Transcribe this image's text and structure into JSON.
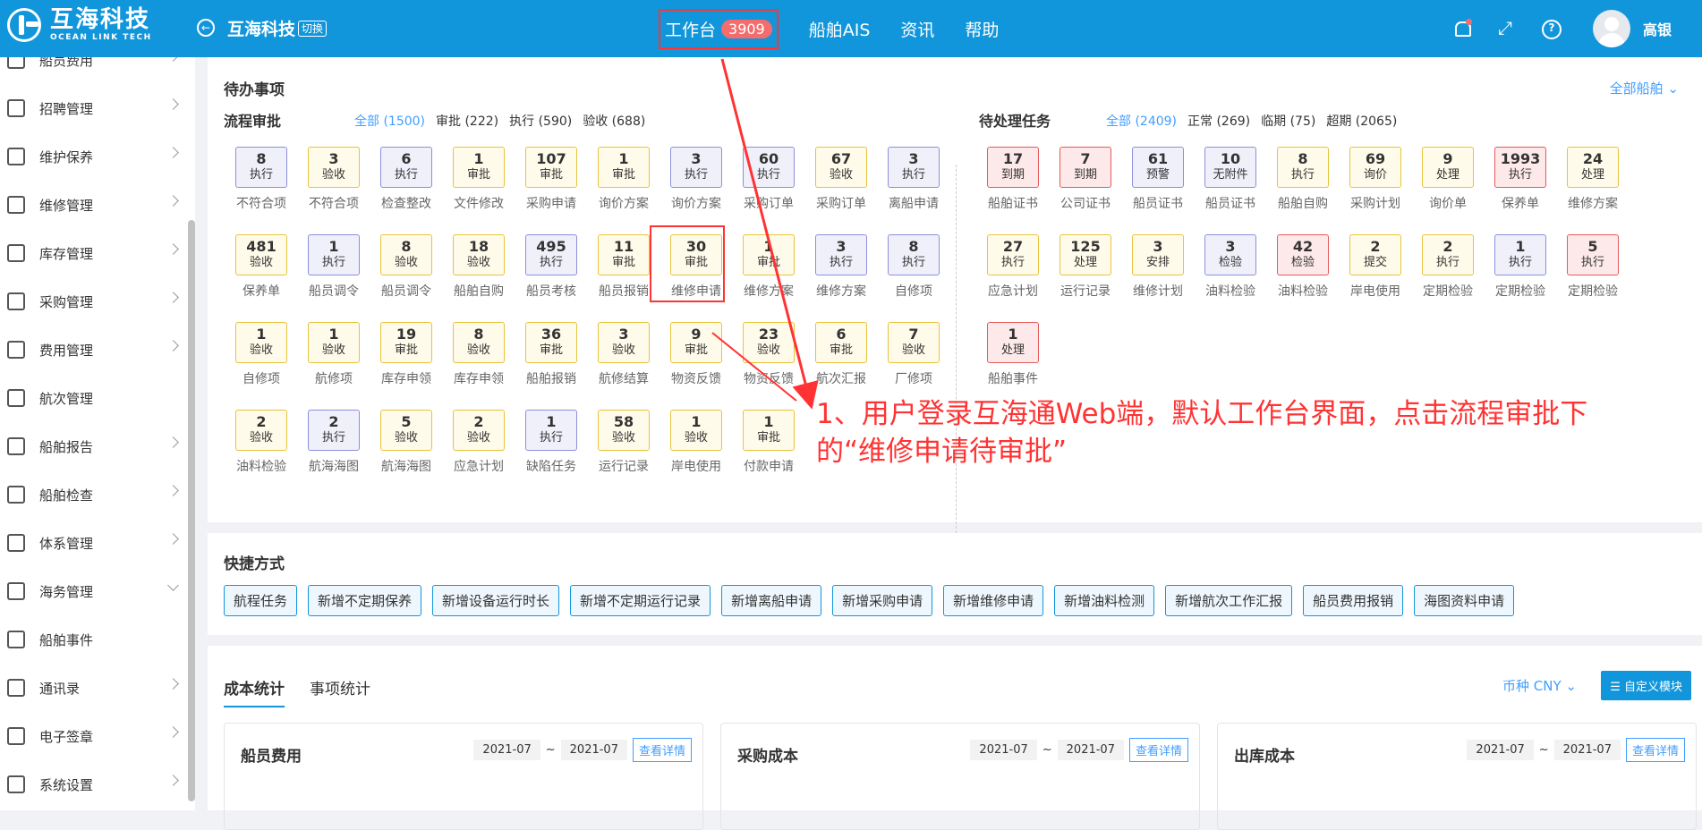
{
  "topbar": {
    "logo_cn": "互海科技",
    "logo_en": "OCEAN LINK TECH",
    "company": "互海科技",
    "switch_label": "切换",
    "nav": [
      {
        "label": "工作台",
        "badge": "3909"
      },
      {
        "label": "船舶AIS"
      },
      {
        "label": "资讯"
      },
      {
        "label": "帮助"
      }
    ],
    "username": "高银"
  },
  "sidebar": {
    "items": [
      {
        "label": "船员费用",
        "icon": "file-fee-icon"
      },
      {
        "label": "招聘管理",
        "icon": "user-icon"
      },
      {
        "label": "维护保养",
        "icon": "tool-icon"
      },
      {
        "label": "维修管理",
        "icon": "wrench-icon"
      },
      {
        "label": "库存管理",
        "icon": "home-icon"
      },
      {
        "label": "采购管理",
        "icon": "cart-icon"
      },
      {
        "label": "费用管理",
        "icon": "coins-icon"
      },
      {
        "label": "航次管理",
        "icon": "globe-icon"
      },
      {
        "label": "船舶报告",
        "icon": "calendar-icon"
      },
      {
        "label": "船舶检查",
        "icon": "check-circle-icon"
      },
      {
        "label": "体系管理",
        "icon": "docs-icon"
      },
      {
        "label": "海务管理",
        "icon": "anchor-icon"
      },
      {
        "label": "船舶事件",
        "icon": "warning-icon"
      },
      {
        "label": "通讯录",
        "icon": "contacts-icon"
      },
      {
        "label": "电子签章",
        "icon": "seal-icon"
      },
      {
        "label": "系统设置",
        "icon": "gear-icon"
      }
    ]
  },
  "todo": {
    "title": "待办事项",
    "all_ships": "全部船舶",
    "process": {
      "title": "流程审批",
      "filters": [
        "全部 (1500)",
        "审批 (222)",
        "执行 (590)",
        "验收 (688)"
      ],
      "items": [
        {
          "n": "8",
          "t": "执行",
          "c": "不符合项",
          "k": "purple"
        },
        {
          "n": "3",
          "t": "验收",
          "c": "不符合项",
          "k": "yellow"
        },
        {
          "n": "6",
          "t": "执行",
          "c": "检查整改",
          "k": "purple"
        },
        {
          "n": "1",
          "t": "审批",
          "c": "文件修改",
          "k": "yellow"
        },
        {
          "n": "107",
          "t": "审批",
          "c": "采购申请",
          "k": "yellow"
        },
        {
          "n": "1",
          "t": "审批",
          "c": "询价方案",
          "k": "yellow"
        },
        {
          "n": "3",
          "t": "执行",
          "c": "询价方案",
          "k": "purple"
        },
        {
          "n": "60",
          "t": "执行",
          "c": "采购订单",
          "k": "purple"
        },
        {
          "n": "67",
          "t": "验收",
          "c": "采购订单",
          "k": "yellow"
        },
        {
          "n": "3",
          "t": "执行",
          "c": "离船申请",
          "k": "purple"
        },
        {
          "n": "481",
          "t": "验收",
          "c": "保养单",
          "k": "yellow"
        },
        {
          "n": "1",
          "t": "执行",
          "c": "船员调令",
          "k": "purple"
        },
        {
          "n": "8",
          "t": "验收",
          "c": "船员调令",
          "k": "yellow"
        },
        {
          "n": "18",
          "t": "验收",
          "c": "船舶自购",
          "k": "yellow"
        },
        {
          "n": "495",
          "t": "执行",
          "c": "船员考核",
          "k": "purple"
        },
        {
          "n": "11",
          "t": "审批",
          "c": "船员报销",
          "k": "yellow"
        },
        {
          "n": "30",
          "t": "审批",
          "c": "维修申请",
          "k": "yellow"
        },
        {
          "n": "1",
          "t": "审批",
          "c": "维修方案",
          "k": "yellow"
        },
        {
          "n": "3",
          "t": "执行",
          "c": "维修方案",
          "k": "purple"
        },
        {
          "n": "8",
          "t": "执行",
          "c": "自修项",
          "k": "purple"
        },
        {
          "n": "1",
          "t": "验收",
          "c": "自修项",
          "k": "yellow"
        },
        {
          "n": "1",
          "t": "验收",
          "c": "航修项",
          "k": "yellow"
        },
        {
          "n": "19",
          "t": "审批",
          "c": "库存申领",
          "k": "yellow"
        },
        {
          "n": "8",
          "t": "验收",
          "c": "库存申领",
          "k": "yellow"
        },
        {
          "n": "36",
          "t": "审批",
          "c": "船舶报销",
          "k": "yellow"
        },
        {
          "n": "3",
          "t": "验收",
          "c": "航修结算",
          "k": "yellow"
        },
        {
          "n": "9",
          "t": "审批",
          "c": "物资反馈",
          "k": "yellow"
        },
        {
          "n": "23",
          "t": "验收",
          "c": "物资反馈",
          "k": "yellow"
        },
        {
          "n": "6",
          "t": "审批",
          "c": "航次汇报",
          "k": "yellow"
        },
        {
          "n": "7",
          "t": "验收",
          "c": "厂修项",
          "k": "yellow"
        },
        {
          "n": "2",
          "t": "验收",
          "c": "油料检验",
          "k": "yellow"
        },
        {
          "n": "2",
          "t": "执行",
          "c": "航海海图",
          "k": "purple"
        },
        {
          "n": "5",
          "t": "验收",
          "c": "航海海图",
          "k": "yellow"
        },
        {
          "n": "2",
          "t": "验收",
          "c": "应急计划",
          "k": "yellow"
        },
        {
          "n": "1",
          "t": "执行",
          "c": "缺陷任务",
          "k": "purple"
        },
        {
          "n": "58",
          "t": "验收",
          "c": "运行记录",
          "k": "yellow"
        },
        {
          "n": "1",
          "t": "验收",
          "c": "岸电使用",
          "k": "yellow"
        },
        {
          "n": "1",
          "t": "审批",
          "c": "付款申请",
          "k": "yellow"
        }
      ]
    },
    "tasks": {
      "title": "待处理任务",
      "filters": [
        "全部 (2409)",
        "正常 (269)",
        "临期 (75)",
        "超期 (2065)"
      ],
      "items": [
        {
          "n": "17",
          "t": "到期",
          "c": "船舶证书",
          "k": "red"
        },
        {
          "n": "7",
          "t": "到期",
          "c": "公司证书",
          "k": "red"
        },
        {
          "n": "61",
          "t": "预警",
          "c": "船员证书",
          "k": "purple"
        },
        {
          "n": "10",
          "t": "无附件",
          "c": "船员证书",
          "k": "purple"
        },
        {
          "n": "8",
          "t": "执行",
          "c": "船舶自购",
          "k": "yellow"
        },
        {
          "n": "69",
          "t": "询价",
          "c": "采购计划",
          "k": "yellow"
        },
        {
          "n": "9",
          "t": "处理",
          "c": "询价单",
          "k": "yellow"
        },
        {
          "n": "1993",
          "t": "执行",
          "c": "保养单",
          "k": "red"
        },
        {
          "n": "24",
          "t": "处理",
          "c": "维修方案",
          "k": "yellow"
        },
        {
          "n": "27",
          "t": "执行",
          "c": "应急计划",
          "k": "yellow"
        },
        {
          "n": "125",
          "t": "处理",
          "c": "运行记录",
          "k": "yellow"
        },
        {
          "n": "3",
          "t": "安排",
          "c": "维修计划",
          "k": "yellow"
        },
        {
          "n": "3",
          "t": "检验",
          "c": "油料检验",
          "k": "purple"
        },
        {
          "n": "42",
          "t": "检验",
          "c": "油料检验",
          "k": "red"
        },
        {
          "n": "2",
          "t": "提交",
          "c": "岸电使用",
          "k": "yellow"
        },
        {
          "n": "2",
          "t": "执行",
          "c": "定期检验",
          "k": "yellow"
        },
        {
          "n": "1",
          "t": "执行",
          "c": "定期检验",
          "k": "purple"
        },
        {
          "n": "5",
          "t": "执行",
          "c": "定期检验",
          "k": "red"
        },
        {
          "n": "1",
          "t": "处理",
          "c": "船舶事件",
          "k": "red"
        }
      ]
    }
  },
  "shortcuts": {
    "title": "快捷方式",
    "items": [
      "航程任务",
      "新增不定期保养",
      "新增设备运行时长",
      "新增不定期运行记录",
      "新增离船申请",
      "新增采购申请",
      "新增维修申请",
      "新增油料检测",
      "新增航次工作汇报",
      "船员费用报销",
      "海图资料申请"
    ]
  },
  "cost": {
    "tabs": [
      "成本统计",
      "事项统计"
    ],
    "currency": "币种 CNY",
    "custom_btn": "自定义模块",
    "cards": [
      {
        "title": "船员费用",
        "from": "2021-07",
        "to": "2021-07",
        "detail": "查看详情"
      },
      {
        "title": "采购成本",
        "from": "2021-07",
        "to": "2021-07",
        "detail": "查看详情"
      },
      {
        "title": "出库成本",
        "from": "2021-07",
        "to": "2021-07",
        "detail": "查看详情"
      }
    ],
    "tilde": "~"
  },
  "annotation": {
    "text": "1、用户登录互海通Web端，默认工作台界面，点击流程审批下的“维修申请待审批”",
    "color": "#ff3333"
  }
}
